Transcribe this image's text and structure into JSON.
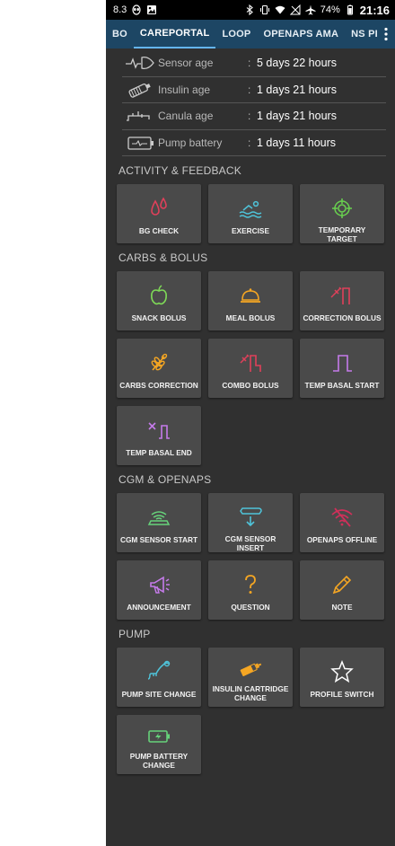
{
  "status_bar": {
    "left_text": "8.3",
    "battery": "74%",
    "time": "21:16"
  },
  "tabs": [
    "BO",
    "CAREPORTAL",
    "LOOP",
    "OPENAPS AMA",
    "NS PROFIL"
  ],
  "info": [
    {
      "icon": "sensor-icon",
      "label": "Sensor age",
      "value": "5 days 22 hours"
    },
    {
      "icon": "insulin-icon",
      "label": "Insulin age",
      "value": "1 days 21 hours"
    },
    {
      "icon": "canula-icon",
      "label": "Canula age",
      "value": "1 days 21 hours"
    },
    {
      "icon": "pump-battery-icon",
      "label": "Pump battery",
      "value": "1 days 11 hours"
    }
  ],
  "sections": {
    "activity": "ACTIVITY & FEEDBACK",
    "carbs": "CARBS & BOLUS",
    "cgm": "CGM & OPENAPS",
    "pump": "PUMP"
  },
  "tiles": {
    "bg_check": "BG CHECK",
    "exercise": "EXERCISE",
    "temporary_target": "TEMPORARY TARGET",
    "snack_bolus": "SNACK BOLUS",
    "meal_bolus": "MEAL BOLUS",
    "correction_bolus": "CORRECTION BOLUS",
    "carbs_correction": "CARBS CORRECTION",
    "combo_bolus": "COMBO BOLUS",
    "temp_basal_start": "TEMP BASAL START",
    "temp_basal_end": "TEMP BASAL END",
    "cgm_sensor_start": "CGM SENSOR START",
    "cgm_sensor_insert": "CGM SENSOR INSERT",
    "openaps_offline": "OPENAPS OFFLINE",
    "announcement": "ANNOUNCEMENT",
    "question": "QUESTION",
    "note": "NOTE",
    "pump_site_change": "PUMP SITE CHANGE",
    "insulin_cartridge_change": "INSULIN CARTRIDGE CHANGE",
    "profile_switch": "PROFILE SWITCH",
    "pump_battery_change": "PUMP BATTERY CHANGE"
  },
  "colors": {
    "tab_bar": "#1d4664",
    "background": "#303030",
    "tile": "#4a4a4a",
    "bg_check": "#e0405a",
    "exercise": "#4fc3d9",
    "target": "#69d14f",
    "snack": "#7ed957",
    "meal": "#f5a623",
    "correction": "#e0405a",
    "carbs": "#f5a623",
    "basal": "#c57bea",
    "cgm": "#66d17a",
    "insert": "#4fc3d9",
    "offline": "#d0305a",
    "announcement": "#c57bea",
    "question": "#f5a623",
    "note": "#f5a623",
    "site": "#4fc3d9",
    "cartridge": "#f5a623",
    "profile": "#ffffff",
    "battery": "#66d17a"
  }
}
